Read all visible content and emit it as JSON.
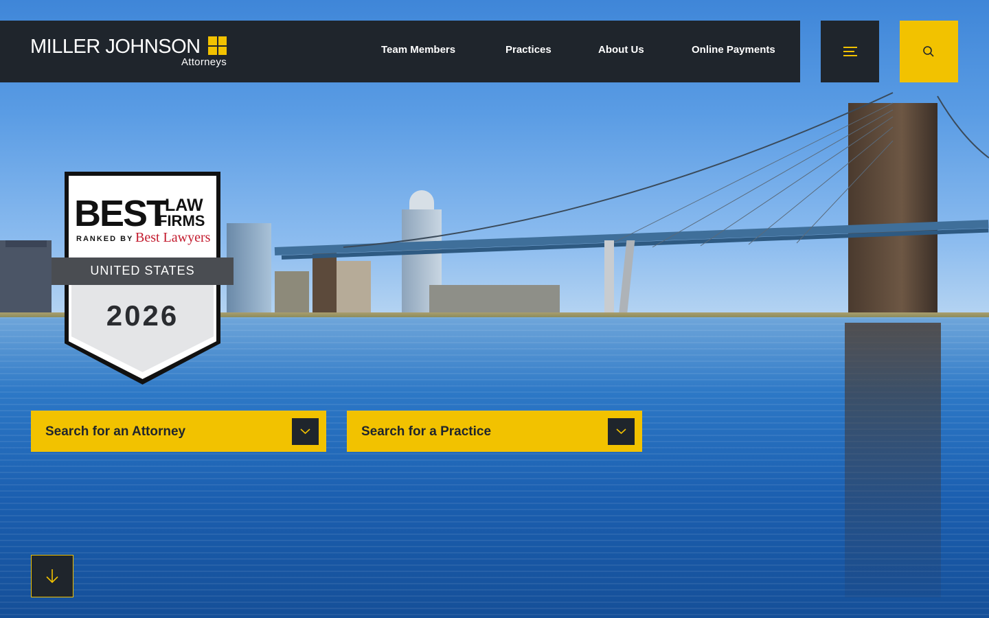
{
  "brand": {
    "name": "MILLER JOHNSON",
    "subtitle": "Attorneys",
    "accent_color": "#f2c200",
    "dark_color": "#1f252c"
  },
  "nav": {
    "items": [
      {
        "label": "Team Members"
      },
      {
        "label": "Practices"
      },
      {
        "label": "About Us"
      },
      {
        "label": "Online Payments"
      }
    ],
    "menu_icon": "hamburger-icon",
    "search_icon": "search-icon"
  },
  "badge": {
    "best": "BEST",
    "law": "LAW",
    "firms": "FIRMS",
    "ranked_by": "RANKED BY",
    "best_lawyers": "Best Lawyers",
    "region": "UNITED STATES",
    "year": "2026"
  },
  "search": {
    "attorney_label": "Search for an Attorney",
    "practice_label": "Search for a Practice",
    "dropdown_icon": "chevron-down-icon"
  },
  "scroll": {
    "icon": "arrow-down-icon"
  }
}
